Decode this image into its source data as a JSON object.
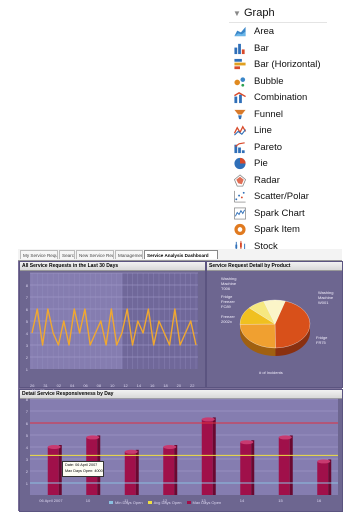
{
  "palette": {
    "header": "Graph",
    "items": [
      {
        "label": "Area",
        "icon": "area-chart-icon"
      },
      {
        "label": "Bar",
        "icon": "bar-chart-icon"
      },
      {
        "label": "Bar (Horizontal)",
        "icon": "horizontal-bar-chart-icon"
      },
      {
        "label": "Bubble",
        "icon": "bubble-chart-icon"
      },
      {
        "label": "Combination",
        "icon": "combination-chart-icon"
      },
      {
        "label": "Funnel",
        "icon": "funnel-chart-icon"
      },
      {
        "label": "Line",
        "icon": "line-chart-icon"
      },
      {
        "label": "Pareto",
        "icon": "pareto-chart-icon"
      },
      {
        "label": "Pie",
        "icon": "pie-chart-icon"
      },
      {
        "label": "Radar",
        "icon": "radar-chart-icon"
      },
      {
        "label": "Scatter/Polar",
        "icon": "scatter-chart-icon"
      },
      {
        "label": "Spark Chart",
        "icon": "spark-chart-icon"
      },
      {
        "label": "Spark Item",
        "icon": "spark-item-icon"
      },
      {
        "label": "Stock",
        "icon": "stock-chart-icon"
      }
    ]
  },
  "dashboard": {
    "tabs": [
      {
        "label": "My Service Requests",
        "active": false
      },
      {
        "label": "Search",
        "active": false
      },
      {
        "label": "New Service Request",
        "active": false
      },
      {
        "label": "Management",
        "active": false
      },
      {
        "label": "Service Analysis Dashboard",
        "active": true
      }
    ],
    "panel_requests_title": "All Service Requests in the Last 30 Days",
    "panel_product_title": "Service Request Detail by Product",
    "panel_response_title": "Detail Service Responsiveness by Day",
    "tooltip": {
      "line1": "Date: 06 April 2007",
      "line2": "Max Days Open: 4000"
    }
  },
  "colors": {
    "dashboard_bg": "#7a6f98",
    "line_series": "#f0a830",
    "bar_series": "#a0104a",
    "max_line": "#e03040",
    "avg_line": "#f0e040"
  },
  "chart_data": [
    {
      "type": "line",
      "title": "All Service Requests in the Last 30 Days",
      "y_ticks": [
        "8",
        "7",
        "6",
        "5",
        "4",
        "3",
        "2",
        "1"
      ],
      "x_ticks": [
        "26",
        "31",
        "02",
        "04",
        "06",
        "08",
        "10",
        "12",
        "14",
        "16",
        "18",
        "20",
        "22"
      ],
      "x_subticks": [
        "Mar 07",
        "Apr"
      ],
      "ylim": [
        0,
        8
      ],
      "series": [
        {
          "values": [
            3,
            5,
            2,
            5,
            3,
            2,
            4,
            2,
            5,
            3,
            5,
            2,
            3,
            4,
            2,
            5,
            2,
            3,
            5,
            2,
            4,
            3,
            5,
            2,
            4,
            3,
            2,
            5,
            2,
            3,
            4,
            2
          ]
        }
      ]
    },
    {
      "type": "pie",
      "title": "Service Request Detail by Product",
      "caption": "# of Incidents",
      "slices": [
        {
          "label": "Washing\nMachine\nW001",
          "value": 45
        },
        {
          "label": "Fridge\nFR75",
          "value": 25
        },
        {
          "label": "Freezer\n2002x",
          "value": 12
        },
        {
          "label": "Fridge\nFreezer\nFC89",
          "value": 8
        },
        {
          "label": "Washing\nMachine\nT006",
          "value": 10
        }
      ]
    },
    {
      "type": "bar",
      "title": "Detail Service Responsiveness by Day",
      "categories": [
        "06 April 2007",
        "10",
        "11",
        "12",
        "13",
        "14",
        "15",
        "16"
      ],
      "y_ticks": [
        "8",
        "7",
        "6",
        "5",
        "4",
        "3",
        "2",
        "1"
      ],
      "ylim": [
        0,
        8
      ],
      "series": [
        {
          "name": "Max Days Open",
          "values": [
            4.0,
            4.8,
            3.6,
            4.0,
            6.3,
            4.4,
            4.8,
            2.8
          ]
        }
      ],
      "reference_lines": [
        {
          "name": "Min Days Open",
          "value": 1.0
        },
        {
          "name": "Avg Days Open",
          "value": 3.3
        },
        {
          "name": "Max Days Open",
          "value": 6.0
        }
      ],
      "legend": [
        "Min Days Open",
        "Avg Days Open",
        "Max Days Open"
      ]
    }
  ]
}
